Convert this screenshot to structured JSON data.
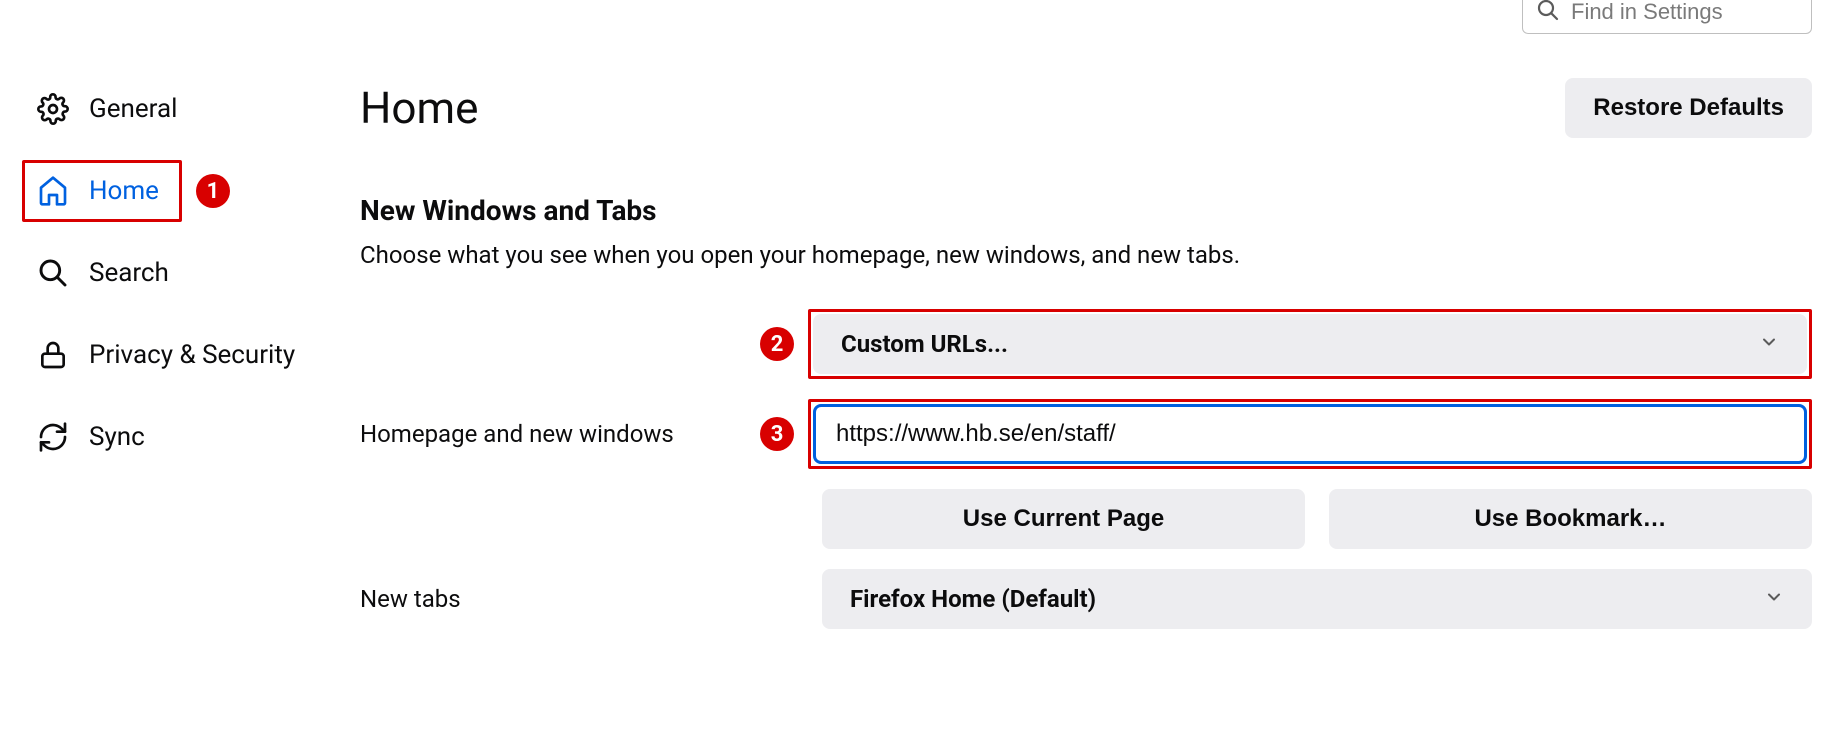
{
  "search": {
    "placeholder": "Find in Settings"
  },
  "sidebar": {
    "items": [
      {
        "label": "General",
        "icon": "gear"
      },
      {
        "label": "Home",
        "icon": "home",
        "active": true,
        "boxed": true,
        "badge": "1"
      },
      {
        "label": "Search",
        "icon": "search"
      },
      {
        "label": "Privacy & Security",
        "icon": "lock"
      },
      {
        "label": "Sync",
        "icon": "sync"
      }
    ]
  },
  "main": {
    "title": "Home",
    "restore_defaults": "Restore Defaults",
    "section_title": "New Windows and Tabs",
    "section_desc": "Choose what you see when you open your homepage, new windows, and new tabs.",
    "homepage_label": "Homepage and new windows",
    "custom_urls_select": "Custom URLs...",
    "homepage_url_value": "https://www.hb.se/en/staff/",
    "use_current_page": "Use Current Page",
    "use_bookmark": "Use Bookmark…",
    "new_tabs_label": "New tabs",
    "new_tabs_select": "Firefox Home (Default)"
  },
  "annotations": {
    "badge2": "2",
    "badge3": "3"
  }
}
